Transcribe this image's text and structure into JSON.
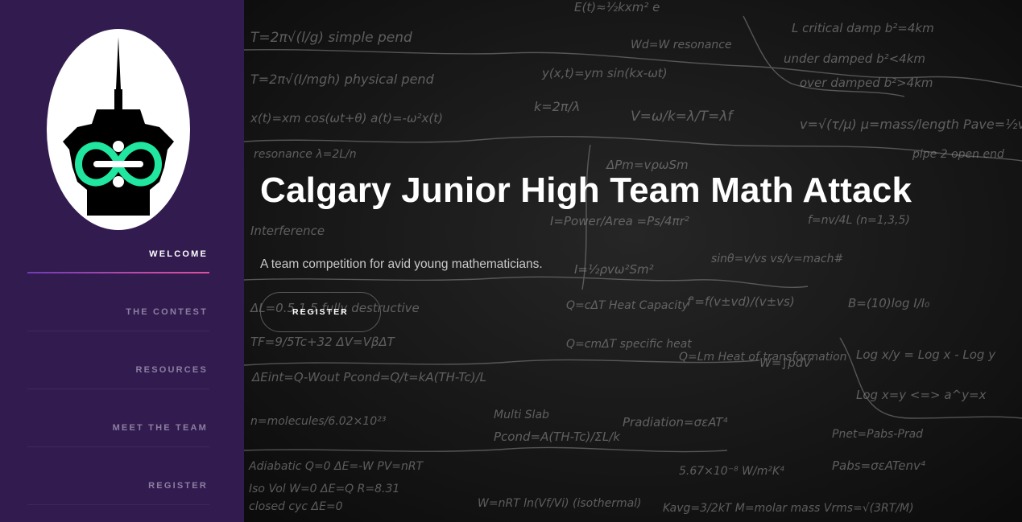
{
  "sidebar": {
    "logo_icon": "tower-infinity-logo",
    "nav": [
      {
        "label": "WELCOME",
        "active": true
      },
      {
        "label": "THE CONTEST",
        "active": false
      },
      {
        "label": "RESOURCES",
        "active": false
      },
      {
        "label": "MEET THE TEAM",
        "active": false
      },
      {
        "label": "REGISTER",
        "active": false
      }
    ]
  },
  "hero": {
    "title": "Calgary Junior High Team Math Attack",
    "subtitle": "A team competition for avid young mathematicians.",
    "button_label": "REGISTER",
    "background": "chalkboard-equations-image"
  },
  "colors": {
    "sidebar_bg": "#321c4f",
    "accent_gradient_start": "#6f3bb5",
    "accent_gradient_end": "#e0509a",
    "logo_green": "#20e6a0"
  }
}
